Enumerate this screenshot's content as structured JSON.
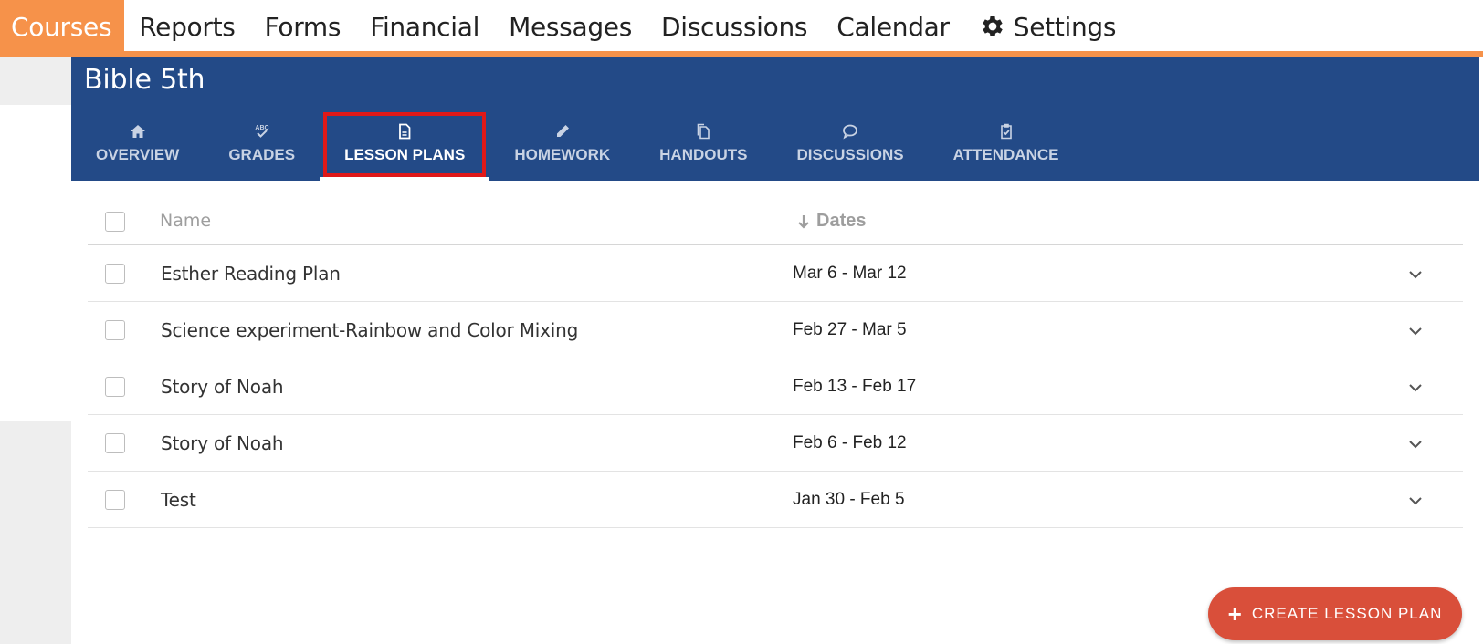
{
  "topnav": {
    "items": [
      "Courses",
      "Reports",
      "Forms",
      "Financial",
      "Messages",
      "Discussions",
      "Calendar"
    ],
    "settings_label": "Settings",
    "accent_color": "#f6924a"
  },
  "course": {
    "title": "Bible 5th",
    "header_color": "#234a87",
    "tabs": [
      {
        "label": "OVERVIEW",
        "icon": "home-icon"
      },
      {
        "label": "GRADES",
        "icon": "grades-icon"
      },
      {
        "label": "LESSON PLANS",
        "icon": "document-icon",
        "active": true
      },
      {
        "label": "HOMEWORK",
        "icon": "pencil-icon"
      },
      {
        "label": "HANDOUTS",
        "icon": "copy-icon"
      },
      {
        "label": "DISCUSSIONS",
        "icon": "speech-bubble-icon"
      },
      {
        "label": "ATTENDANCE",
        "icon": "clipboard-check-icon"
      }
    ]
  },
  "table": {
    "headers": {
      "name": "Name",
      "dates": "Dates"
    },
    "rows": [
      {
        "name": "Esther Reading Plan",
        "dates": "Mar 6 - Mar 12"
      },
      {
        "name": "Science experiment-Rainbow and Color Mixing",
        "dates": "Feb 27 - Mar 5"
      },
      {
        "name": "Story of Noah",
        "dates": "Feb 13 - Feb 17"
      },
      {
        "name": "Story of Noah",
        "dates": "Feb 6 - Feb 12"
      },
      {
        "name": "Test",
        "dates": "Jan 30 - Feb 5"
      }
    ]
  },
  "create_button": {
    "label": "CREATE LESSON PLAN",
    "color": "#d94f3a"
  }
}
